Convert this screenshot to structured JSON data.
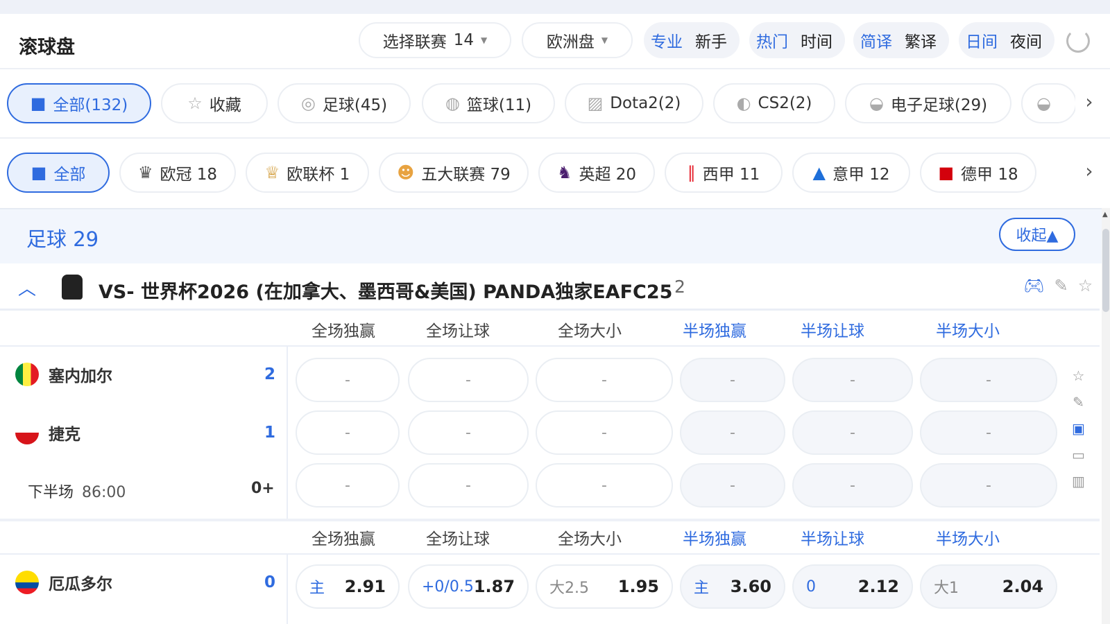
{
  "header": {
    "title": "滚球盘",
    "league_select": {
      "label": "选择联赛",
      "count": "14"
    },
    "odds_select": "欧洲盘",
    "toggles": [
      {
        "on": "专业",
        "off": "新手"
      },
      {
        "on": "热门",
        "off": "时间"
      },
      {
        "on": "简译",
        "off": "繁译"
      },
      {
        "on": "日间",
        "off": "夜间"
      }
    ]
  },
  "sports": [
    {
      "label": "全部(132)",
      "icon": "grid-icon"
    },
    {
      "label": "收藏",
      "icon": "star-icon"
    },
    {
      "label": "足球(45)",
      "icon": "soccer-icon"
    },
    {
      "label": "篮球(11)",
      "icon": "basketball-icon"
    },
    {
      "label": "Dota2(2)",
      "icon": "dota-icon"
    },
    {
      "label": "CS2(2)",
      "icon": "cs2-icon"
    },
    {
      "label": "电子足球(29)",
      "icon": "esoccer-icon"
    }
  ],
  "leagues": [
    {
      "label": "全部",
      "icon": "grid-icon"
    },
    {
      "label": "欧冠 18",
      "icon": "ucl-icon"
    },
    {
      "label": "欧联杯 1",
      "icon": "uel-icon"
    },
    {
      "label": "五大联赛 79",
      "icon": "top5-icon"
    },
    {
      "label": "英超 20",
      "icon": "epl-icon"
    },
    {
      "label": "西甲 11",
      "icon": "laliga-icon"
    },
    {
      "label": "意甲 12",
      "icon": "seriea-icon"
    },
    {
      "label": "德甲 18",
      "icon": "bundesliga-icon"
    }
  ],
  "section": {
    "title": "足球 29",
    "collapse": "收起▲"
  },
  "league": {
    "name": "VS- 世界杯2026 (在加拿大、墨西哥&美国) PANDA独家EAFC25",
    "count": "2"
  },
  "columns": [
    "全场独赢",
    "全场让球",
    "全场大小",
    "半场独赢",
    "半场让球",
    "半场大小"
  ],
  "matches": [
    {
      "home": {
        "name": "塞内加尔",
        "score": "2"
      },
      "away": {
        "name": "捷克",
        "score": "1"
      },
      "period": "下半场",
      "time": "86:00",
      "more": "0+",
      "rows": [
        [
          "-",
          "-",
          "-",
          "-",
          "-",
          "-"
        ],
        [
          "-",
          "-",
          "-",
          "-",
          "-",
          "-"
        ],
        [
          "-",
          "-",
          "-",
          "-",
          "-",
          "-"
        ]
      ]
    },
    {
      "home": {
        "name": "厄瓜多尔",
        "score": "0"
      },
      "odds": [
        {
          "label": "主",
          "value": "2.91"
        },
        {
          "label": "+0/0.5",
          "value": "1.87"
        },
        {
          "label": "大2.5",
          "value": "1.95"
        },
        {
          "label": "主",
          "value": "3.60"
        },
        {
          "label": "0",
          "value": "2.12"
        },
        {
          "label": "大1",
          "value": "2.04"
        }
      ]
    }
  ],
  "colors": {
    "accent": "#2f6bdf",
    "senegal": [
      "#00853f",
      "#fdef42",
      "#e31b23"
    ],
    "czech": [
      "#ffffff",
      "#d7141a",
      "#11457e"
    ]
  }
}
